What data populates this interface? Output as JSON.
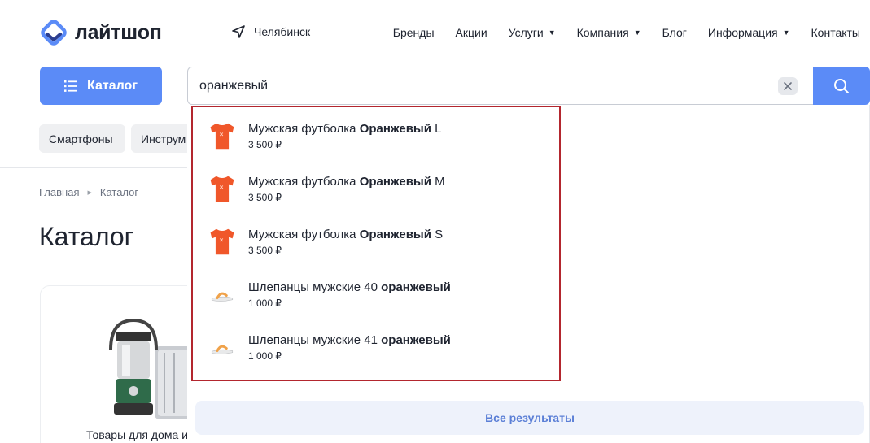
{
  "header": {
    "logo_text": "лайтшоп",
    "city": "Челябинск",
    "nav": [
      {
        "label": "Бренды",
        "has_caret": false
      },
      {
        "label": "Акции",
        "has_caret": false
      },
      {
        "label": "Услуги",
        "has_caret": true
      },
      {
        "label": "Компания",
        "has_caret": true
      },
      {
        "label": "Блог",
        "has_caret": false
      },
      {
        "label": "Информация",
        "has_caret": true
      },
      {
        "label": "Контакты",
        "has_caret": false
      }
    ],
    "caret_glyph": "▼"
  },
  "catalog_button": {
    "label": "Каталог"
  },
  "search": {
    "value": "оранжевый"
  },
  "chips": [
    "Смартфоны",
    "Инструм"
  ],
  "breadcrumb": {
    "home": "Главная",
    "current": "Каталог"
  },
  "page_title": "Каталог",
  "category_card": {
    "label": "Товары для дома и"
  },
  "suggestions": [
    {
      "prefix": "Мужская футболка ",
      "highlight": "Оранжевый",
      "suffix": " L",
      "price": "3 500 ₽",
      "icon": "tshirt-icon"
    },
    {
      "prefix": "Мужская футболка ",
      "highlight": "Оранжевый",
      "suffix": " M",
      "price": "3 500 ₽",
      "icon": "tshirt-icon"
    },
    {
      "prefix": "Мужская футболка ",
      "highlight": "Оранжевый",
      "suffix": " S",
      "price": "3 500 ₽",
      "icon": "tshirt-icon"
    },
    {
      "prefix": "Шлепанцы мужские 40 ",
      "highlight": "оранжевый",
      "suffix": "",
      "price": "1 000 ₽",
      "icon": "slipper-icon"
    },
    {
      "prefix": "Шлепанцы мужские 41 ",
      "highlight": "оранжевый",
      "suffix": "",
      "price": "1 000 ₽",
      "icon": "slipper-icon"
    }
  ],
  "all_results_label": "Все результаты",
  "colors": {
    "accent": "#5b8bf7",
    "highlight_border": "#b3262e",
    "product_orange": "#f0572a"
  }
}
